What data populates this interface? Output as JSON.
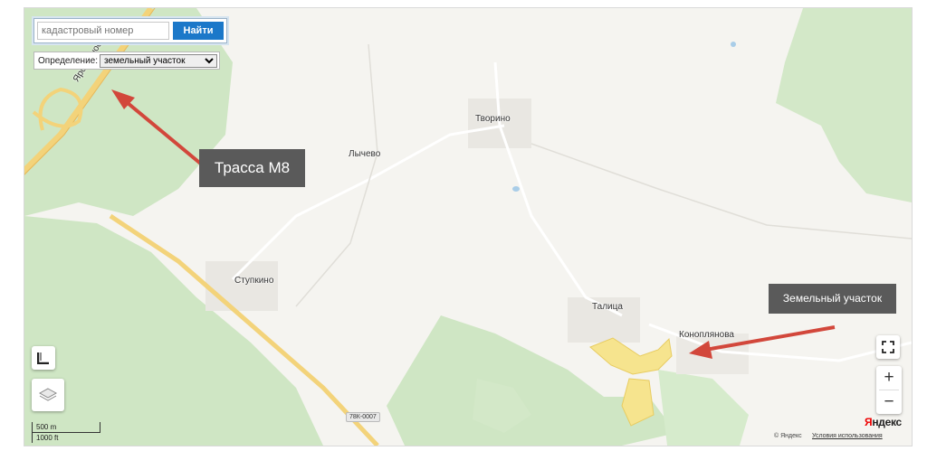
{
  "search": {
    "placeholder": "кадастровый номер",
    "button_label": "Найти"
  },
  "definition": {
    "label": "Определение:",
    "selected": "земельный участок",
    "options": [
      "земельный участок"
    ]
  },
  "map": {
    "places": [
      "Творино",
      "Лычево",
      "Ступкино",
      "Талица",
      "Коноплянова"
    ],
    "road_label": "Яросл.шоссе",
    "road_badge": "78К-0007"
  },
  "annotations": {
    "highway": "Трасса М8",
    "plot": "Земельный участок"
  },
  "scale": {
    "metric": "500 m",
    "imperial": "1000 ft"
  },
  "footer": {
    "copyright": "© Яндекс",
    "terms": "Условия использования",
    "logo_first": "Я",
    "logo_rest": "ндекс"
  },
  "colors": {
    "forest": "#cfe6c4",
    "road": "#f3d37a",
    "plot": "#f6e48e",
    "arrow": "#d2473b",
    "callout": "#5a5a5a",
    "button": "#1b78c9"
  },
  "controls": {
    "fullscreen_icon": "fullscreen-icon",
    "ruler_icon": "ruler-icon",
    "layers_icon": "layers-icon",
    "zoom_in": "+",
    "zoom_out": "−"
  }
}
